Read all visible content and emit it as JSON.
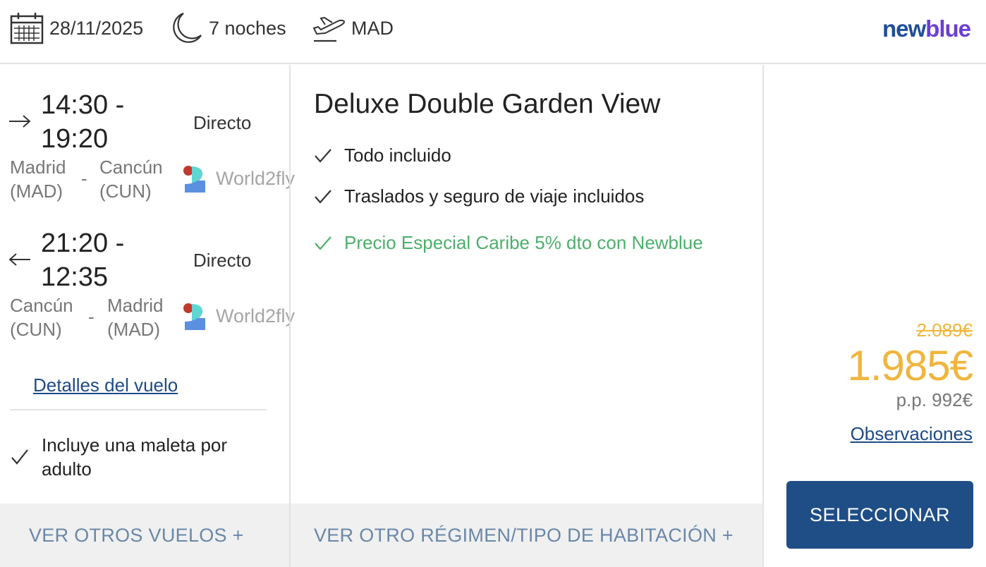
{
  "header": {
    "date": "28/11/2025",
    "nights": "7 noches",
    "origin": "MAD",
    "brand_part1": "new",
    "brand_part2": "blue"
  },
  "flights": [
    {
      "direction": "outbound",
      "time_start": "14:30 -",
      "time_end": "19:20",
      "type": "Directo",
      "from_city": "Madrid",
      "from_code": "(MAD)",
      "to_city": "Cancún",
      "to_code": "(CUN)",
      "separator": "-",
      "airline": "World2fly"
    },
    {
      "direction": "return",
      "time_start": "21:20 -",
      "time_end": "12:35",
      "type": "Directo",
      "from_city": "Cancún",
      "from_code": "(CUN)",
      "to_city": "Madrid",
      "to_code": "(MAD)",
      "separator": "-",
      "airline": "World2fly"
    }
  ],
  "flight_details_link": "Detalles del vuelo",
  "luggage": "Incluye una maleta por adulto",
  "room": {
    "title": "Deluxe Double Garden View",
    "features": [
      "Todo incluido",
      "Traslados y seguro de viaje incluidos",
      "Precio Especial Caribe 5% dto con Newblue"
    ]
  },
  "price": {
    "old": "2.089€",
    "current": "1.985€",
    "per_person": "p.p. 992€",
    "notes_link": "Observaciones",
    "select_label": "SELECCIONAR"
  },
  "bottom": {
    "other_flights": "VER OTROS VUELOS +",
    "other_regime": "VER OTRO RÉGIMEN/TIPO DE HABITACIÓN +"
  },
  "colors": {
    "price": "#f0b53d",
    "link": "#1f4a85",
    "button": "#1f4e87",
    "promo_green": "#4caf6a"
  }
}
